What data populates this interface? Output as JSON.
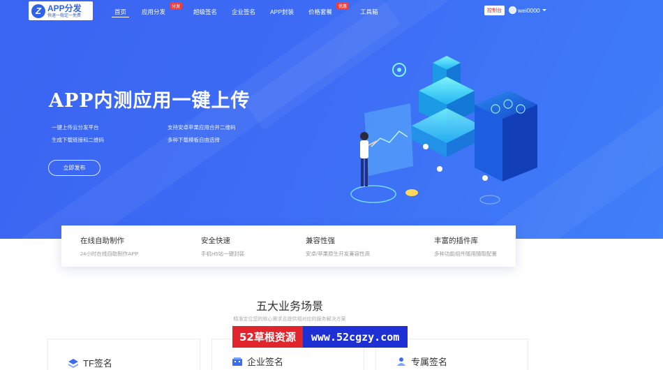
{
  "logo": {
    "name": "APP分发",
    "tagline": "快速一稳定一免费"
  },
  "nav": {
    "items": [
      {
        "label": "首页",
        "active": true
      },
      {
        "label": "应用分发",
        "badge": "分发"
      },
      {
        "label": "超级签名"
      },
      {
        "label": "企业签名"
      },
      {
        "label": "APP封装"
      },
      {
        "label": "价格套餐",
        "badge": "优惠"
      },
      {
        "label": "工具箱"
      }
    ]
  },
  "account": {
    "console_label": "控制台",
    "username": "wei0000"
  },
  "hero": {
    "title": "APP内测应用一键上传",
    "features": [
      "一键上传云分发平台",
      "支持安卓苹果应用合并二维码",
      "生成下载链接和二维码",
      "多种下载模板自由选择"
    ],
    "cta_label": "立即发布"
  },
  "advantages": [
    {
      "title": "在线自助制作",
      "desc": "24小时在线自助制作APP"
    },
    {
      "title": "安全快速",
      "desc": "手机H5站一键封装"
    },
    {
      "title": "兼容性强",
      "desc": "安卓/苹果原生开发兼容性高"
    },
    {
      "title": "丰富的插件库",
      "desc": "多种功能组件随用随取配置"
    }
  ],
  "section": {
    "title": "五大业务场景",
    "subtitle": "精准定位您的核心需求且提供相对应的服务解决方案"
  },
  "scenes": [
    {
      "label": "TF签名",
      "icon": "layers-icon"
    },
    {
      "label": "企业签名",
      "icon": "building-icon"
    },
    {
      "label": "专属签名",
      "icon": "user-badge-icon"
    }
  ],
  "watermark": {
    "left": "52草根资源",
    "right": "www.52cgzy.com"
  },
  "colors": {
    "hero": "#3d6cf5",
    "badge": "#f23d3d",
    "accent": "#2f62e8"
  }
}
